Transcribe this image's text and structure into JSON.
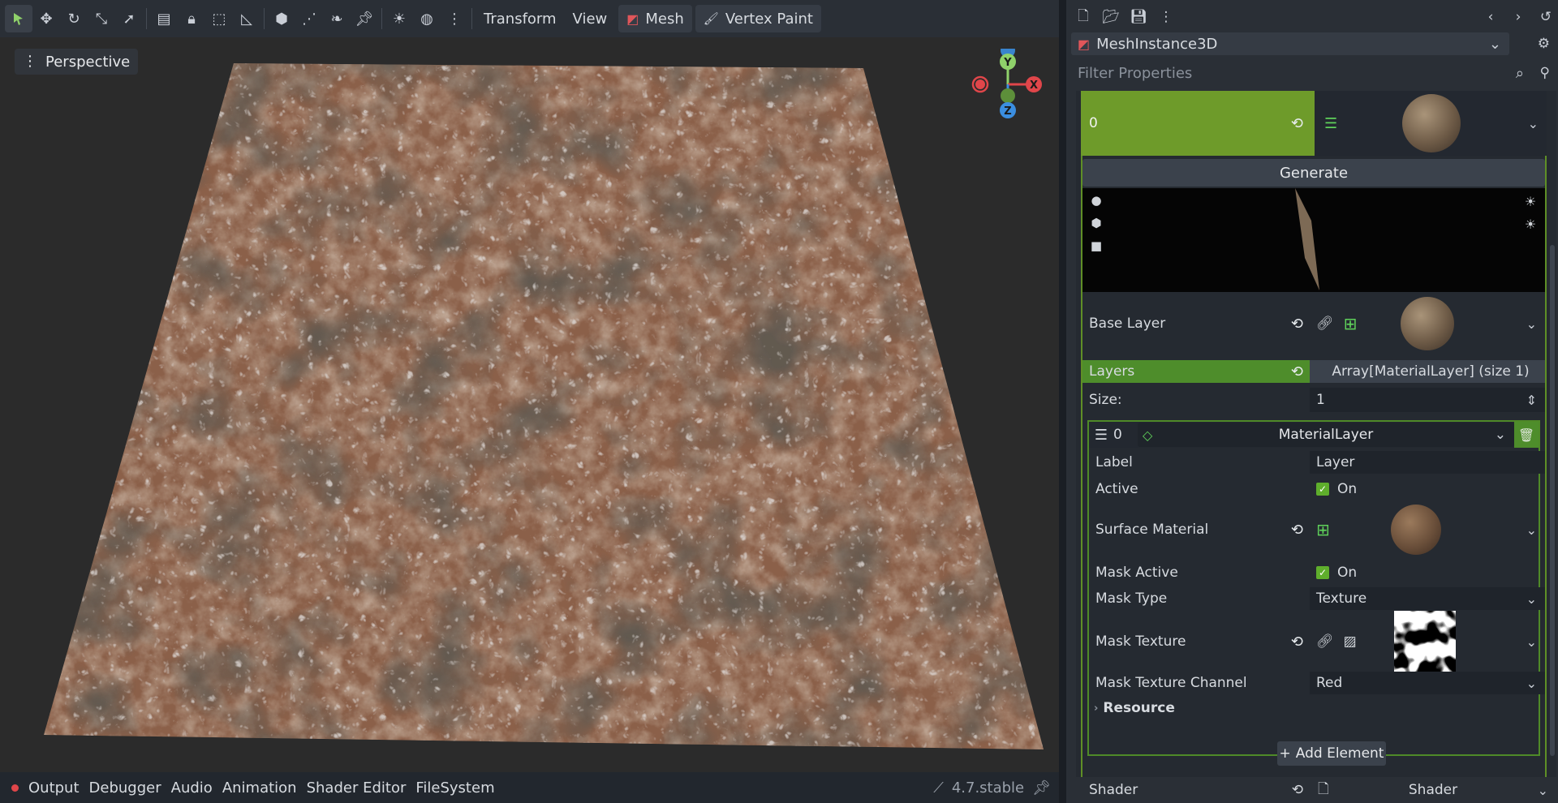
{
  "toolbar": {
    "transform_label": "Transform",
    "view_label": "View",
    "mesh_label": "Mesh",
    "vertex_paint_label": "Vertex Paint"
  },
  "viewport": {
    "perspective_label": "Perspective",
    "gizmo": {
      "y": "Y",
      "x": "X",
      "z": "Z"
    }
  },
  "bottom_bar": {
    "tabs": [
      "Output",
      "Debugger",
      "Audio",
      "Animation",
      "Shader Editor",
      "FileSystem"
    ],
    "version": "4.7.stable"
  },
  "inspector": {
    "node_name": "MeshInstance3D",
    "filter_placeholder": "Filter Properties",
    "material_index": "0",
    "generate_label": "Generate",
    "base_layer_label": "Base Layer",
    "layers_label": "Layers",
    "layers_value": "Array[MaterialLayer] (size 1)",
    "size_label": "Size:",
    "size_value": "1",
    "element_index": "0",
    "element_type": "MaterialLayer",
    "props": {
      "label_label": "Label",
      "label_value": "Layer",
      "active_label": "Active",
      "active_value": "On",
      "surface_material_label": "Surface Material",
      "mask_active_label": "Mask Active",
      "mask_active_value": "On",
      "mask_type_label": "Mask Type",
      "mask_type_value": "Texture",
      "mask_texture_label": "Mask Texture",
      "mask_channel_label": "Mask Texture Channel",
      "mask_channel_value": "Red",
      "resource_label": "Resource"
    },
    "add_element_label": "Add Element",
    "shader_label": "Shader",
    "shader_value": "Shader"
  },
  "colors": {
    "accent_green": "#6e9b2a",
    "layers_green": "#4e8d2b",
    "panel_bg": "#2a2f36"
  }
}
